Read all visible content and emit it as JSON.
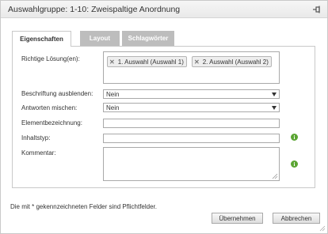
{
  "dialog": {
    "title": "Auswahlgruppe: 1-10: Zweispaltige Anordnung",
    "pin_icon": "pin-icon"
  },
  "tabs": [
    {
      "label": "Eigenschaften",
      "active": true
    },
    {
      "label": "Layout",
      "active": false
    },
    {
      "label": "Schlagwörter",
      "active": false
    }
  ],
  "form": {
    "correct_answers": {
      "label": "Richtige Lösung(en):",
      "chips": [
        "1. Auswahl (Auswahl 1)",
        "2. Auswahl (Auswahl 2)"
      ],
      "remove_icon": "close-icon"
    },
    "hide_caption": {
      "label": "Beschriftung ausblenden:",
      "value": "Nein"
    },
    "shuffle_answers": {
      "label": "Antworten mischen:",
      "value": "Nein"
    },
    "element_name": {
      "label": "Elementbezeichnung:",
      "value": ""
    },
    "content_type": {
      "label": "Inhaltstyp:",
      "value": "",
      "info_icon": "info-icon"
    },
    "comment": {
      "label": "Kommentar:",
      "value": "",
      "info_icon": "info-icon"
    }
  },
  "footnote": "Die mit * gekennzeichneten Felder sind Pflichtfelder.",
  "buttons": {
    "ok": "Übernehmen",
    "cancel": "Abbrechen"
  },
  "colors": {
    "info": "#5aa532",
    "tab_inactive": "#bdbdbd",
    "border": "#c9c9c9"
  }
}
